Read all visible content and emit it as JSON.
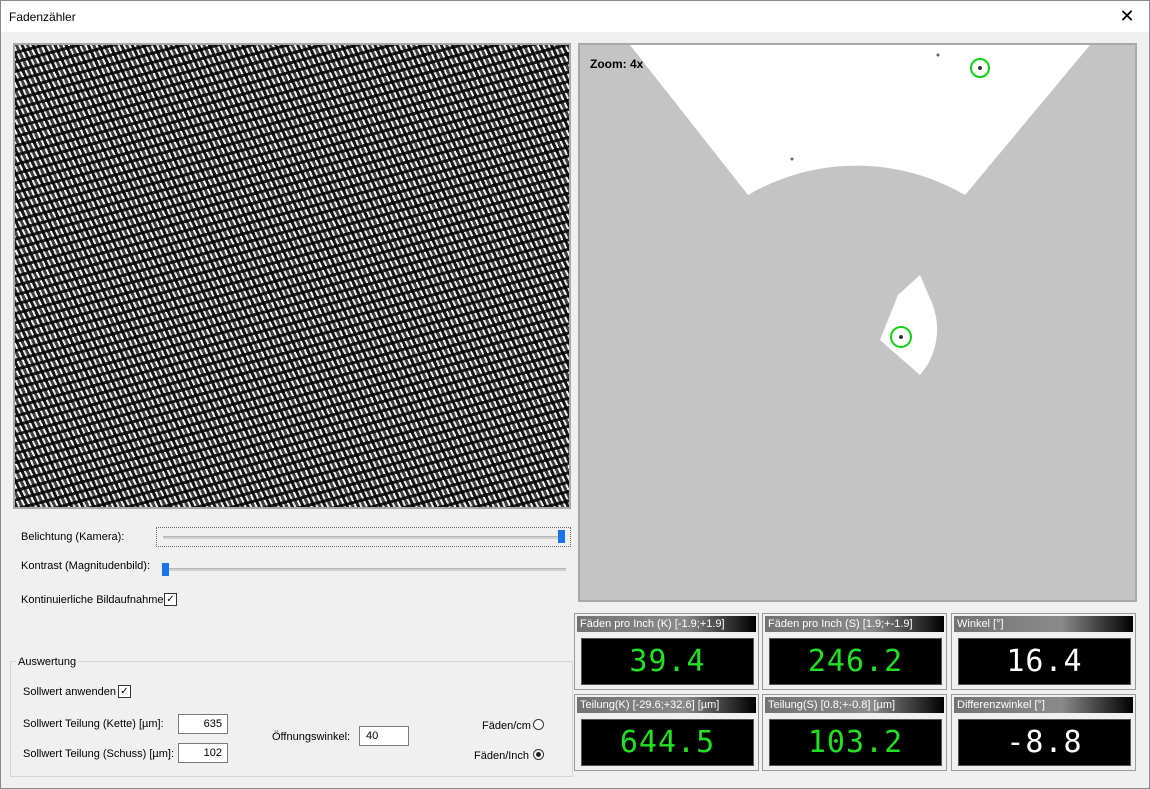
{
  "window": {
    "title": "Fadenzähler",
    "close_glyph": "✕"
  },
  "magnitude_view": {
    "zoom_label": "Zoom: 4x"
  },
  "controls": {
    "exposure_label": "Belichtung (Kamera):",
    "exposure_value": 1.0,
    "contrast_label": "Kontrast (Magnitudenbild):",
    "contrast_value": 0.0,
    "continuous_label": "Kontinuierliche Bildaufnahme",
    "continuous_checked": "✓"
  },
  "evaluation": {
    "group_title": "Auswertung",
    "apply_label": "Sollwert anwenden",
    "apply_checked": "✓",
    "warp_label": "Sollwert Teilung (Kette) [µm]:",
    "warp_value": "635",
    "weft_label": "Sollwert Teilung (Schuss) [µm]:",
    "weft_value": "102",
    "angle_label": "Öffnungswinkel:",
    "angle_value": "40",
    "unit_cm_label": "Fäden/cm",
    "unit_inch_label": "Fäden/Inch"
  },
  "panels": [
    {
      "title": "Fäden pro Inch (K)  [-1.9;+1.9]",
      "value": "39.4",
      "color": "#22e022"
    },
    {
      "title": "Fäden pro Inch (S)  [1.9;+-1.9]",
      "value": "246.2",
      "color": "#22e022"
    },
    {
      "title": "Winkel [°]",
      "value": "16.4",
      "color": "#ffffff"
    },
    {
      "title": "Teilung(K)  [-29.6;+32.6] [µm]",
      "value": "644.5",
      "color": "#22e022"
    },
    {
      "title": "Teilung(S)  [0.8;+-0.8] [µm]",
      "value": "103.2",
      "color": "#22e022"
    },
    {
      "title": "Differenzwinkel [°]",
      "value": "-8.8",
      "color": "#ffffff"
    }
  ]
}
